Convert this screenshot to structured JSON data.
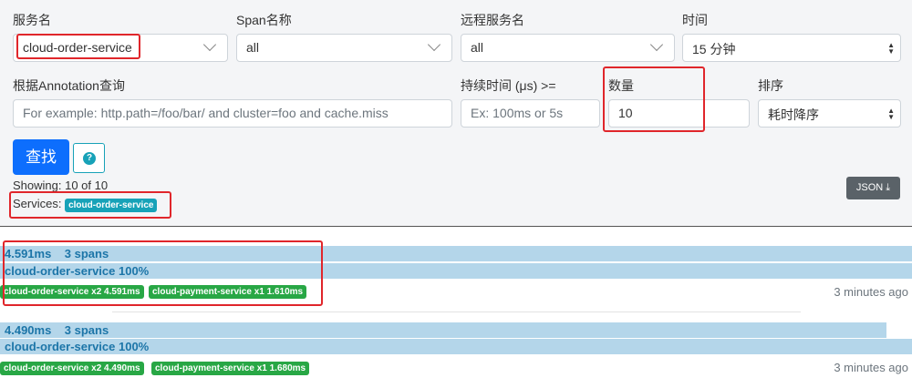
{
  "form": {
    "service_label": "服务名",
    "service_value": "cloud-order-service",
    "span_label": "Span名称",
    "span_value": "all",
    "remote_label": "远程服务名",
    "remote_value": "all",
    "time_label": "时间",
    "time_value": "15 分钟",
    "annotation_label": "根据Annotation查询",
    "annotation_placeholder": "For example: http.path=/foo/bar/ and cluster=foo and cache.miss",
    "duration_label": "持续时间 (μs) >=",
    "duration_placeholder": "Ex: 100ms or 5s",
    "limit_label": "数量",
    "limit_value": "10",
    "sort_label": "排序",
    "sort_value": "耗时降序",
    "find_button": "查找",
    "help_icon": "?"
  },
  "summary": {
    "showing": "Showing: 10 of 10",
    "services_label": "Services:",
    "service_badge": "cloud-order-service",
    "json_button": "JSON"
  },
  "colors": {
    "primary": "#0d6efd",
    "info": "#17a2b8",
    "success": "#28a745",
    "bar": "#b4d6ea",
    "annotation": "#e0262b"
  },
  "traces": [
    {
      "duration": "4.591ms",
      "spans": "3 spans",
      "service_pct": "cloud-order-service 100%",
      "bar_percent": 100,
      "badges": [
        "cloud-order-service x2 4.591ms",
        "cloud-payment-service x1 1.610ms"
      ],
      "ago": "3 minutes ago"
    },
    {
      "duration": "4.490ms",
      "spans": "3 spans",
      "service_pct": "cloud-order-service 100%",
      "bar_percent": 97.2,
      "badges": [
        "cloud-order-service x2 4.490ms",
        "cloud-payment-service x1 1.680ms"
      ],
      "ago": "3 minutes ago"
    }
  ]
}
